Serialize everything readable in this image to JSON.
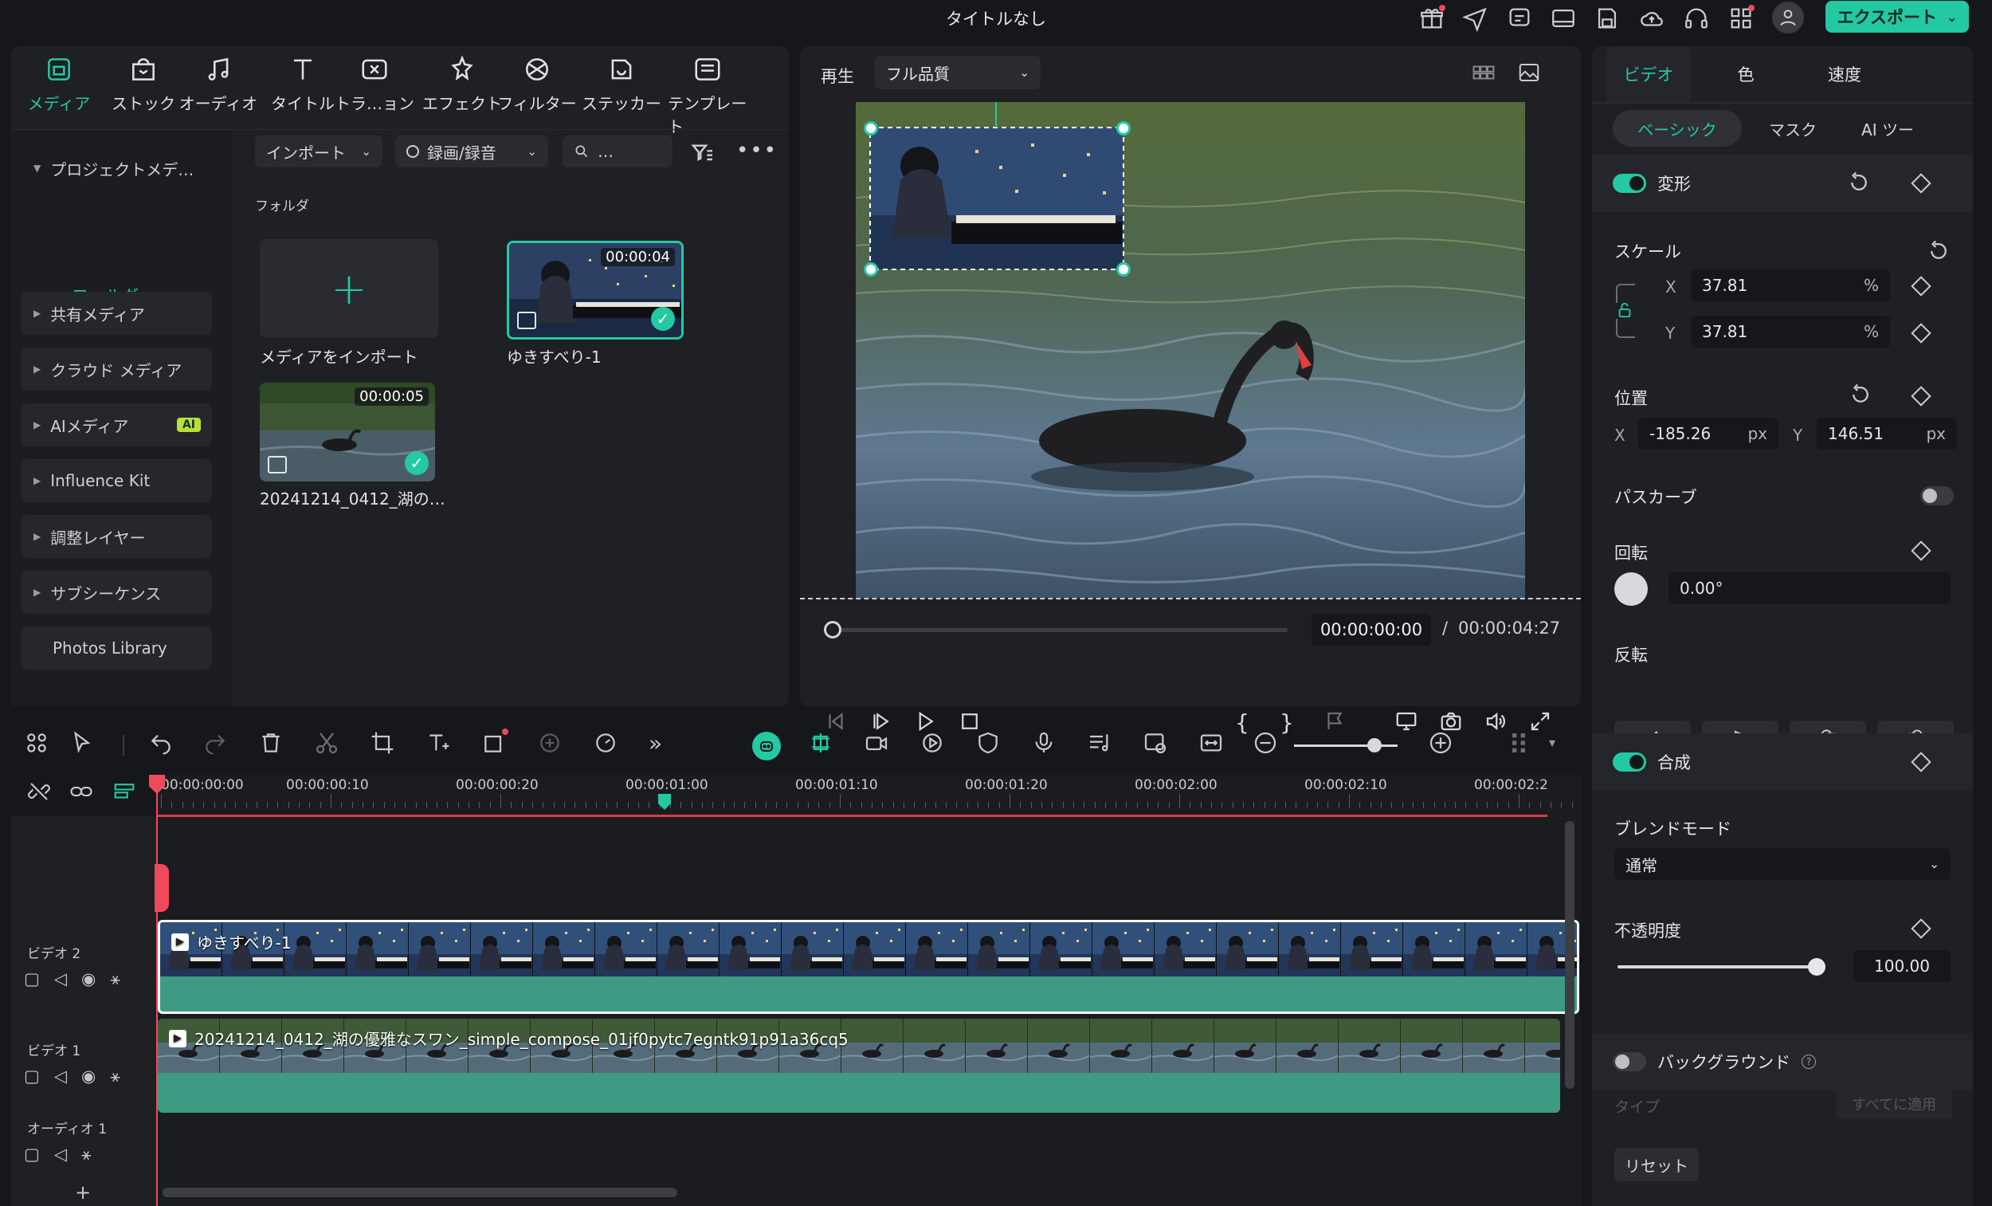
{
  "app": {
    "title": "タイトルなし",
    "export_label": "エクスポート",
    "accent": "#23c9a3",
    "top_icons": [
      "gift-icon",
      "send-icon",
      "comment-icon",
      "layout-icon",
      "save-icon",
      "cloud-icon",
      "headset-icon",
      "apps-icon",
      "user-icon"
    ]
  },
  "media": {
    "tabs": [
      {
        "label": "メディア",
        "icon": "media-icon",
        "active": true
      },
      {
        "label": "ストック",
        "icon": "stock-icon"
      },
      {
        "label": "オーディオ",
        "icon": "audio-icon"
      },
      {
        "label": "タイトル",
        "icon": "title-icon"
      },
      {
        "label": "トラ…ョン",
        "icon": "transition-icon"
      },
      {
        "label": "エフェクト",
        "icon": "effect-icon"
      },
      {
        "label": "フィルター",
        "icon": "filter-icon"
      },
      {
        "label": "ステッカー",
        "icon": "sticker-icon"
      },
      {
        "label": "テンプレート",
        "icon": "template-icon"
      }
    ],
    "sidebar": {
      "project": "プロジェクトメデ…",
      "folder": "フォルダ",
      "items": [
        "共有メディア",
        "クラウド メディア",
        "AIメディア",
        "Influence Kit",
        "調整レイヤー",
        "サブシーケンス"
      ],
      "ai_badge": "AI",
      "photos": "Photos Library"
    },
    "toolbar": {
      "import": "インポート",
      "record": "録画/録音",
      "search_placeholder": "…"
    },
    "folder_label": "フォルダ",
    "import_card_label": "メディアをインポート",
    "clips": [
      {
        "name": "ゆきすべり-1",
        "duration": "00:00:04"
      },
      {
        "name": "20241214_0412_湖の…",
        "duration": "00:00:05"
      }
    ]
  },
  "preview": {
    "play_label": "再生",
    "quality": "フル品質",
    "time_current": "00:00:00:00",
    "time_separator": "/",
    "time_total": "00:00:04:27",
    "progress": 0
  },
  "inspector": {
    "tabs": [
      "ビデオ",
      "色",
      "速度"
    ],
    "subtabs": [
      "ベーシック",
      "マスク",
      "AI ツー"
    ],
    "transform": {
      "label": "変形",
      "scale_label": "スケール",
      "x_label": "X",
      "y_label": "Y",
      "scale_x": "37.81",
      "scale_y": "37.81",
      "scale_unit": "%",
      "position_label": "位置",
      "pos_x": "-185.26",
      "pos_y": "146.51",
      "pos_unit": "px",
      "path_curve": "パスカーブ",
      "rotation_label": "回転",
      "rotation": "0.00°",
      "flip_label": "反転"
    },
    "composite": {
      "label": "合成",
      "blend_label": "ブレンドモード",
      "blend": "通常",
      "opacity_label": "不透明度",
      "opacity": "100.00",
      "opacity_level": 1.0
    },
    "background": {
      "label": "バックグラウンド",
      "type_label": "タイプ",
      "apply_all": "すべてに適用"
    },
    "reset": "リセット"
  },
  "timeline": {
    "ruler": [
      "00:00:00:00",
      "00:00:00:10",
      "00:00:00:20",
      "00:00:01:00",
      "00:00:01:10",
      "00:00:01:20",
      "00:00:02:00",
      "00:00:02:10",
      "00:00:02:2"
    ],
    "tracks": [
      {
        "name": "ビデオ 2",
        "clip": "ゆきすべり-1"
      },
      {
        "name": "ビデオ 1",
        "clip": "20241214_0412_湖の優雅なスワン_simple_compose_01jf0pytc7egntk91p91a36cq5"
      },
      {
        "name": "オーディオ 1",
        "clip": ""
      }
    ],
    "add_track": "+",
    "zoom_level": 0.78
  }
}
